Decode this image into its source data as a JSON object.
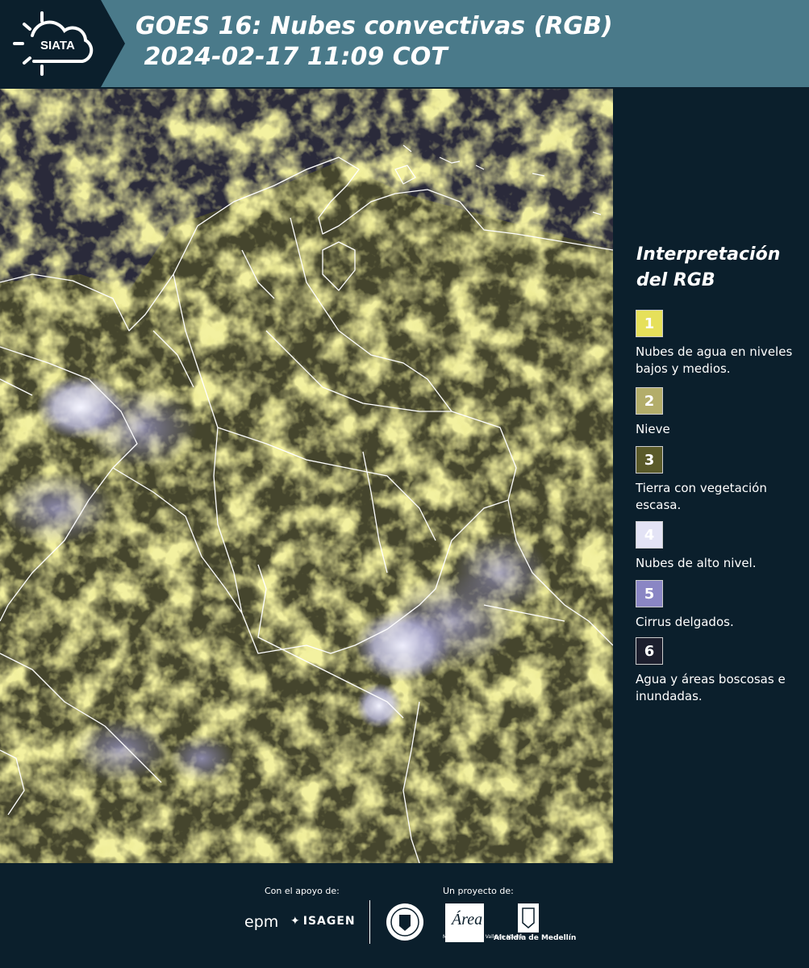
{
  "header": {
    "logo_text": "SIATA",
    "title": "GOES 16: Nubes convectivas (RGB)\n 2024-02-17 11:09 COT"
  },
  "legend": {
    "title": "Interpretación del RGB",
    "items": [
      {
        "number": "1",
        "label": "Nubes de agua en niveles bajos y medios.",
        "color": "#e6e05a"
      },
      {
        "number": "2",
        "label": "Nieve",
        "color": "#b3ad6a"
      },
      {
        "number": "3",
        "label": "Tierra con vegetación escasa.",
        "color": "#5a5a2a"
      },
      {
        "number": "4",
        "label": "Nubes de alto nivel.",
        "color": "#e3e3f5"
      },
      {
        "number": "5",
        "label": "Cirrus delgados.",
        "color": "#8a86c4"
      },
      {
        "number": "6",
        "label": "Agua y áreas boscosas e inundadas.",
        "color": "#1d1f2e"
      }
    ]
  },
  "footer": {
    "support_label": "Con el apoyo de:",
    "project_label": "Un proyecto de:",
    "sponsor1": "epm",
    "sponsor2": "ISAGEN",
    "partner1": "METROPOLITANA Valle de Aburrá",
    "partner1_logo": "Área",
    "partner2": "Alcaldía de Medellín"
  },
  "colors": {
    "header_bg": "#4a7a8a",
    "page_bg": "#0b1f2c",
    "cloud_yellow": "#e6e05a",
    "ground_dark": "#2a2a3a"
  }
}
